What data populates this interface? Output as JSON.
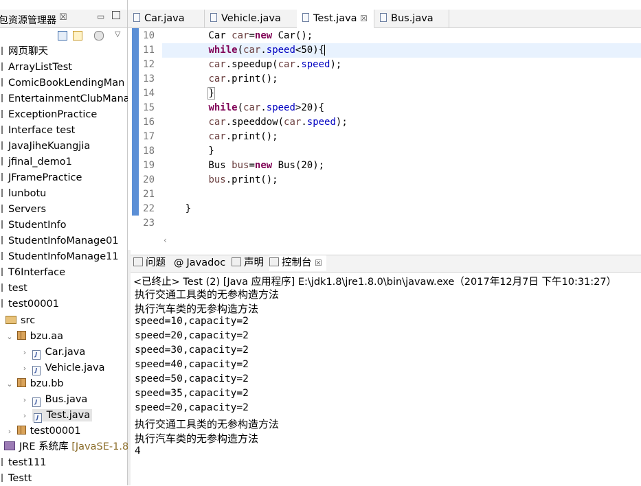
{
  "explorer": {
    "title": "包资源管理器",
    "close": "☒",
    "minimize": "▭",
    "items": [
      {
        "label": "网页聊天"
      },
      {
        "label": "ArrayListTest"
      },
      {
        "label": "ComicBookLendingMan"
      },
      {
        "label": "EntertainmentClubMana"
      },
      {
        "label": "ExceptionPractice"
      },
      {
        "label": "Interface test"
      },
      {
        "label": "JavaJiheKuangjia"
      },
      {
        "label": "jfinal_demo1"
      },
      {
        "label": "JFramePractice"
      },
      {
        "label": "lunbotu"
      },
      {
        "label": "Servers"
      },
      {
        "label": "StudentInfo"
      },
      {
        "label": "StudentInfoManage01"
      },
      {
        "label": "StudentInfoManage11"
      },
      {
        "label": "T6Interface"
      },
      {
        "label": "test"
      },
      {
        "label": "test00001"
      }
    ],
    "src": "src",
    "pkg_aa": "bzu.aa",
    "car": "Car.java",
    "vehicle": "Vehicle.java",
    "pkg_bb": "bzu.bb",
    "bus": "Bus.java",
    "test": "Test.java",
    "test00001_pkg": "test00001",
    "jre": "JRE 系统库",
    "jre_version": "[JavaSE-1.8",
    "test111": "test111",
    "testt": "Testt"
  },
  "editor": {
    "tabs": [
      {
        "label": "Car.java"
      },
      {
        "label": "Vehicle.java"
      },
      {
        "label": "Test.java"
      },
      {
        "label": "Bus.java"
      }
    ],
    "close_mark": "☒",
    "line_numbers": [
      "10",
      "11",
      "12",
      "13",
      "14",
      "15",
      "16",
      "17",
      "18",
      "19",
      "20",
      "21",
      "22",
      "23"
    ]
  },
  "bottom": {
    "tabs": [
      {
        "label": "问题"
      },
      {
        "label": "Javadoc"
      },
      {
        "label": "声明"
      },
      {
        "label": "控制台"
      }
    ],
    "close_mark": "☒",
    "status": "<已终止> Test (2) [Java 应用程序] E:\\jdk1.8\\jre1.8.0\\bin\\javaw.exe（2017年12月7日 下午10:31:27）",
    "output": [
      "执行交通工具类的无参构造方法",
      "执行汽车类的无参构造方法",
      "speed=10,capacity=2",
      "speed=20,capacity=2",
      "speed=30,capacity=2",
      "speed=40,capacity=2",
      "speed=50,capacity=2",
      "speed=35,capacity=2",
      "speed=20,capacity=2",
      "执行交通工具类的无参构造方法",
      "执行汽车类的无参构造方法",
      "4"
    ]
  },
  "colors": {
    "keyword": "#7f0055",
    "field": "#0000c0",
    "current_line": "#e8f2fe",
    "ruler": "#5b8fd6"
  }
}
